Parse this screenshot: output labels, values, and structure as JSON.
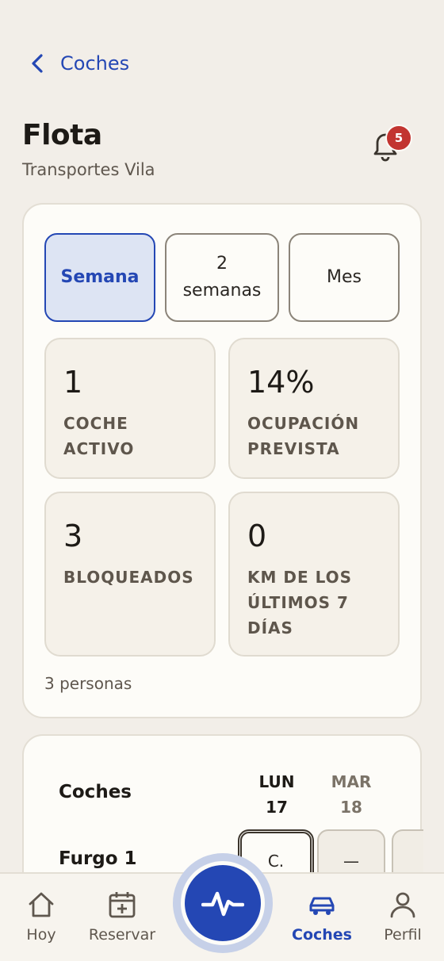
{
  "header": {
    "back_label": "Coches",
    "title": "Flota",
    "subtitle": "Transportes Vila",
    "notification_count": "5"
  },
  "range": {
    "options": [
      "Semana",
      "2 semanas",
      "Mes"
    ],
    "selected": "Semana"
  },
  "stats": [
    {
      "value": "1",
      "label": "Coche activo"
    },
    {
      "value": "14%",
      "label": "Ocupación prevista"
    },
    {
      "value": "3",
      "label": "Bloqueados"
    },
    {
      "value": "0",
      "label": "Km de los últimos 7 días"
    }
  ],
  "people_count": "3 personas",
  "schedule": {
    "heading": "Coches",
    "days": [
      {
        "dow": "LUN",
        "date": "17"
      },
      {
        "dow": "MAR",
        "date": "18"
      }
    ],
    "rows": [
      {
        "name": "Furgo 1",
        "cells": [
          "C.",
          "—",
          ""
        ]
      }
    ]
  },
  "tabbar": {
    "items": [
      {
        "label": "Hoy",
        "icon": "home-icon"
      },
      {
        "label": "Reservar",
        "icon": "calendar-plus-icon"
      },
      {
        "label": "Coches",
        "icon": "car-icon"
      },
      {
        "label": "Perfil",
        "icon": "user-icon"
      }
    ],
    "active": "Coches",
    "fab_icon": "activity-icon"
  },
  "colors": {
    "accent": "#2447b4",
    "background": "#f2eee8",
    "badge": "#c23430"
  }
}
